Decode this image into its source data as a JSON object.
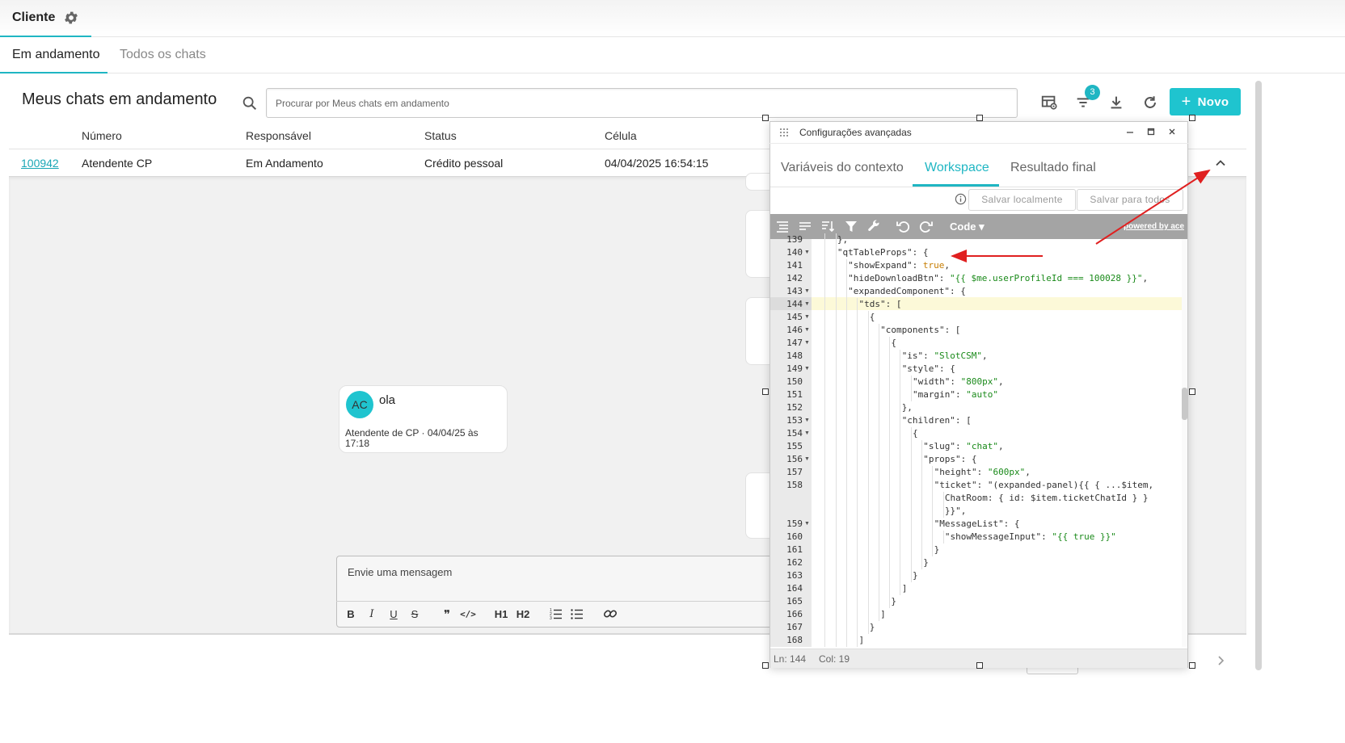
{
  "app": {
    "tab_label": "Cliente",
    "subtabs": [
      "Em andamento",
      "Todos os chats"
    ]
  },
  "page": {
    "title": "Meus chats em andamento",
    "search_placeholder": "Procurar por Meus chats em andamento",
    "filter_badge": "3",
    "new_button": "Novo"
  },
  "table": {
    "headers": [
      "Número",
      "Responsável",
      "Status",
      "Célula"
    ],
    "row": {
      "id": "100942",
      "numero": "Atendente CP",
      "responsavel": "Em Andamento",
      "status": "Crédito pessoal",
      "celula": "04/04/2025 16:54:15"
    }
  },
  "chat": {
    "avatar_initials": "AC",
    "message": "ola",
    "meta": "Atendente de CP · 04/04/25 às 17:18",
    "composer_placeholder": "Envie uma mensagem",
    "format_tools": [
      "B",
      "I",
      "U",
      "S",
      "❞",
      "</>",
      "H1",
      "H2",
      "ordered-list",
      "bullet-list",
      "link"
    ]
  },
  "modal": {
    "title": "Configurações avançadas",
    "tabs": [
      "Variáveis do contexto",
      "Workspace",
      "Resultado final"
    ],
    "active_tab": "Workspace",
    "save_local": "Salvar localmente",
    "save_all": "Salvar para todos",
    "editor_mode": "Code ▾",
    "powered_by": "powered by ace",
    "status_ln": "Ln: 144",
    "status_col": "Col: 19",
    "code_lines": [
      {
        "n": "139",
        "fold": false,
        "indent": 3,
        "text": "},"
      },
      {
        "n": "140",
        "fold": true,
        "indent": 3,
        "text": "\"qtTableProps\": {"
      },
      {
        "n": "141",
        "fold": false,
        "indent": 4,
        "text": "\"showExpand\": true,"
      },
      {
        "n": "142",
        "fold": false,
        "indent": 4,
        "text": "\"hideDownloadBtn\": \"{{ $me.userProfileId === 100028 }}\","
      },
      {
        "n": "143",
        "fold": true,
        "indent": 4,
        "text": "\"expandedComponent\": {"
      },
      {
        "n": "144",
        "fold": true,
        "indent": 5,
        "text": "\"tds\": ["
      },
      {
        "n": "145",
        "fold": true,
        "indent": 6,
        "text": "{"
      },
      {
        "n": "146",
        "fold": true,
        "indent": 7,
        "text": "\"components\": ["
      },
      {
        "n": "147",
        "fold": true,
        "indent": 8,
        "text": "{"
      },
      {
        "n": "148",
        "fold": false,
        "indent": 9,
        "text": "\"is\": \"SlotCSM\","
      },
      {
        "n": "149",
        "fold": true,
        "indent": 9,
        "text": "\"style\": {"
      },
      {
        "n": "150",
        "fold": false,
        "indent": 10,
        "text": "\"width\": \"800px\","
      },
      {
        "n": "151",
        "fold": false,
        "indent": 10,
        "text": "\"margin\": \"auto\""
      },
      {
        "n": "152",
        "fold": false,
        "indent": 9,
        "text": "},"
      },
      {
        "n": "153",
        "fold": true,
        "indent": 9,
        "text": "\"children\": ["
      },
      {
        "n": "154",
        "fold": true,
        "indent": 10,
        "text": "{"
      },
      {
        "n": "155",
        "fold": false,
        "indent": 11,
        "text": "\"slug\": \"chat\","
      },
      {
        "n": "156",
        "fold": true,
        "indent": 11,
        "text": "\"props\": {"
      },
      {
        "n": "157",
        "fold": false,
        "indent": 12,
        "text": "\"height\": \"600px\","
      },
      {
        "n": "158",
        "fold": false,
        "indent": 12,
        "text": "\"ticket\": \"(expanded-panel){{ { ...$item,"
      },
      {
        "n": "",
        "fold": false,
        "indent": 13,
        "text": "ChatRoom: { id: $item.ticketChatId } }"
      },
      {
        "n": "",
        "fold": false,
        "indent": 13,
        "text": "}}\","
      },
      {
        "n": "159",
        "fold": true,
        "indent": 12,
        "text": "\"MessageList\": {"
      },
      {
        "n": "160",
        "fold": false,
        "indent": 13,
        "text": "\"showMessageInput\": \"{{ true }}\""
      },
      {
        "n": "161",
        "fold": false,
        "indent": 12,
        "text": "}"
      },
      {
        "n": "162",
        "fold": false,
        "indent": 11,
        "text": "}"
      },
      {
        "n": "163",
        "fold": false,
        "indent": 10,
        "text": "}"
      },
      {
        "n": "164",
        "fold": false,
        "indent": 9,
        "text": "]"
      },
      {
        "n": "165",
        "fold": false,
        "indent": 8,
        "text": "}"
      },
      {
        "n": "166",
        "fold": false,
        "indent": 7,
        "text": "]"
      },
      {
        "n": "167",
        "fold": false,
        "indent": 6,
        "text": "}"
      },
      {
        "n": "168",
        "fold": false,
        "indent": 5,
        "text": "]"
      }
    ]
  },
  "colors": {
    "accent": "#1fb6c3",
    "button": "#1fc4cf",
    "annotation_arrow": "#e02020"
  }
}
